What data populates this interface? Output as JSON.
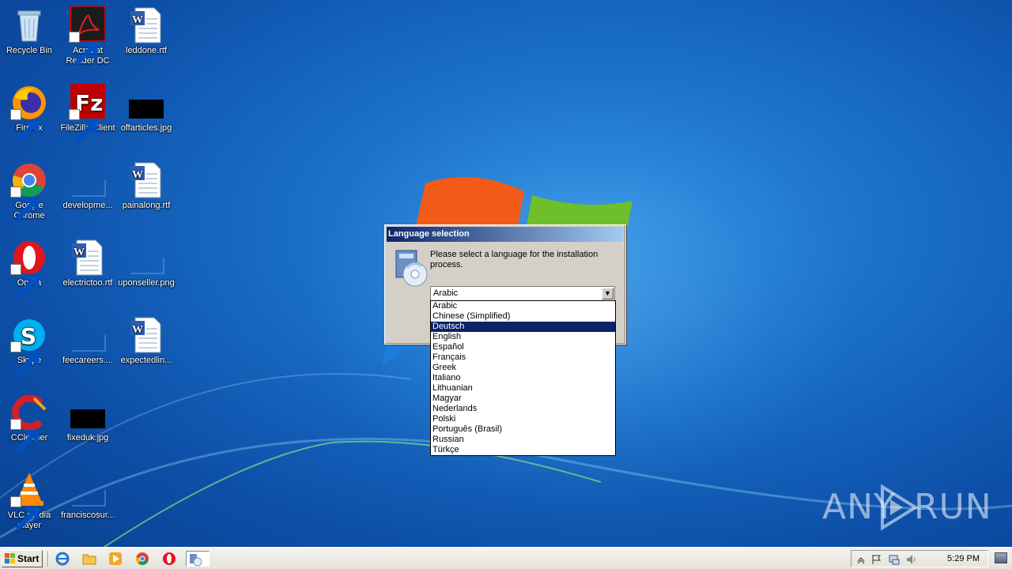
{
  "desktop": {
    "icons": [
      {
        "label": "Recycle Bin",
        "icon": "recycle-bin-icon"
      },
      {
        "label": "Acrobat Reader DC",
        "icon": "acrobat-icon"
      },
      {
        "label": "leddone.rtf",
        "icon": "word-document-icon"
      },
      {
        "label": "Firefox",
        "icon": "firefox-icon"
      },
      {
        "label": "FileZilla Client",
        "icon": "filezilla-icon"
      },
      {
        "label": "offarticles.jpg",
        "icon": "image-file-icon"
      },
      {
        "label": "Google Chrome",
        "icon": "chrome-icon"
      },
      {
        "label": "developme...",
        "icon": "blank-file-icon"
      },
      {
        "label": "painalong.rtf",
        "icon": "word-document-icon"
      },
      {
        "label": "Opera",
        "icon": "opera-icon"
      },
      {
        "label": "electrictoo.rtf",
        "icon": "word-document-icon"
      },
      {
        "label": "uponseller.png",
        "icon": "blank-file-icon"
      },
      {
        "label": "Skype",
        "icon": "skype-icon"
      },
      {
        "label": "feecareers....",
        "icon": "blank-file-icon"
      },
      {
        "label": "expectedlin...",
        "icon": "word-document-icon"
      },
      {
        "label": "CCleaner",
        "icon": "ccleaner-icon"
      },
      {
        "label": "fixeduk.jpg",
        "icon": "image-file-icon"
      },
      {
        "label": "VLC media player",
        "icon": "vlc-icon"
      },
      {
        "label": "franciscosur...",
        "icon": "blank-file-icon"
      }
    ]
  },
  "dialog": {
    "title": "Language selection",
    "prompt": "Please select a language for the installation process.",
    "selected_value": "Arabic",
    "options": [
      "Arabic",
      "Chinese (Simplified)",
      "Deutsch",
      "English",
      "Español",
      "Français",
      "Greek",
      "Italiano",
      "Lithuanian",
      "Magyar",
      "Nederlands",
      "Polski",
      "Português (Brasil)",
      "Russian",
      "Türkçe"
    ],
    "highlighted_option": "Deutsch"
  },
  "watermark": {
    "left": "ANY",
    "right": "RUN"
  },
  "taskbar": {
    "start_label": "Start",
    "clock": "5:29 PM",
    "accent_color": "#0a246a"
  }
}
